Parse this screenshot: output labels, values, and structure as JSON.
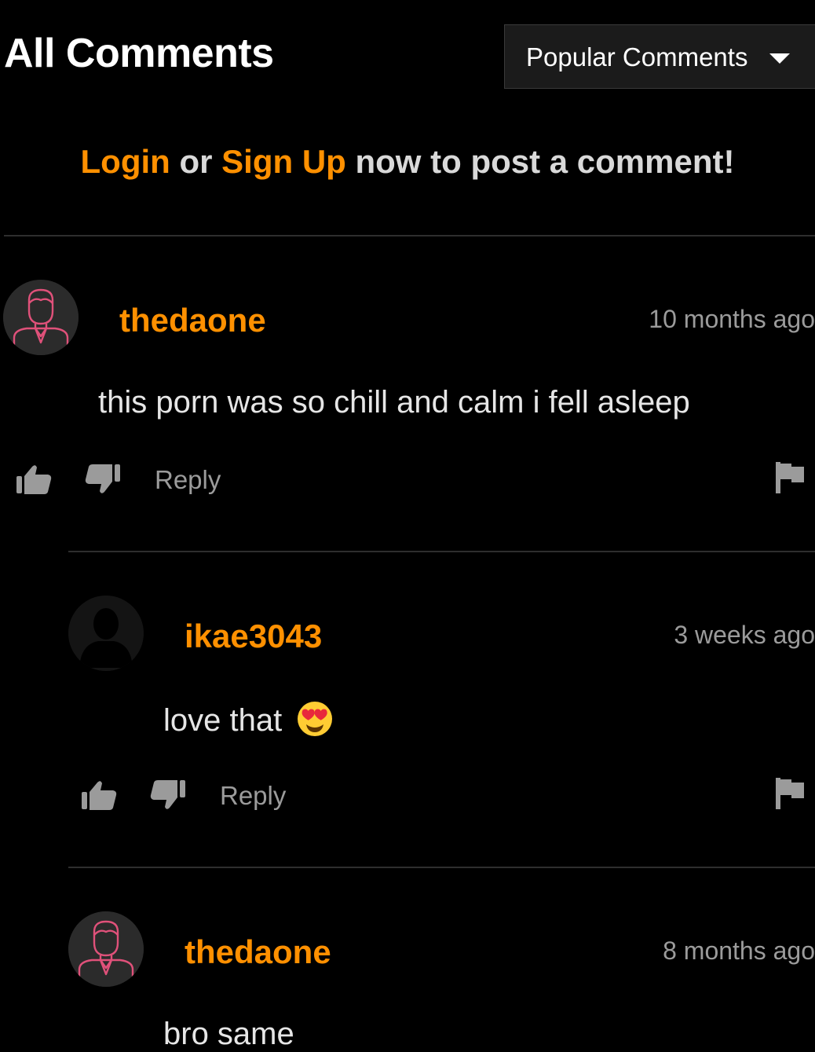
{
  "header": {
    "title": "All Comments",
    "sort_selected": "Popular Comments"
  },
  "login_prompt": {
    "login_label": "Login",
    "or_text": " or ",
    "signup_label": "Sign Up",
    "suffix_text": " now to post a comment!"
  },
  "colors": {
    "accent": "#ff9000",
    "background": "#000000",
    "muted_text": "#9b9b9b",
    "avatar_line": "#e0517a"
  },
  "comments": [
    {
      "username": "thedaone",
      "time": "10 months ago",
      "text": "this porn was so chill and calm i fell asleep",
      "reply_label": "Reply",
      "avatar_icon": "user-outline-icon"
    },
    {
      "username": "ikae3043",
      "time": "3 weeks ago",
      "text": "love that",
      "emoji": "heart-eyes-emoji",
      "reply_label": "Reply",
      "avatar_icon": "silhouette-icon"
    },
    {
      "username": "thedaone",
      "time": "8 months ago",
      "text": "bro same",
      "avatar_icon": "user-outline-icon"
    }
  ]
}
